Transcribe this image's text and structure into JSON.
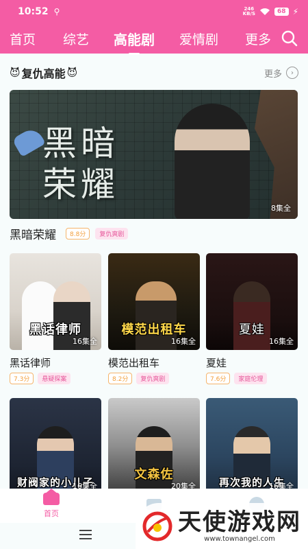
{
  "status_bar": {
    "time": "10:52",
    "usb_icon": "usb-icon",
    "network_speed_value": "246",
    "network_speed_unit": "KB/S",
    "battery": "68"
  },
  "top_nav": {
    "tabs": [
      {
        "label": "首页",
        "active": false
      },
      {
        "label": "综艺",
        "active": false
      },
      {
        "label": "高能剧",
        "active": true
      },
      {
        "label": "爱情剧",
        "active": false
      },
      {
        "label": "更多",
        "active": false
      }
    ],
    "search_icon": "search-icon"
  },
  "section": {
    "title": "复仇高能",
    "more_label": "更多"
  },
  "featured": {
    "poster_title_line1": "黑暗",
    "poster_title_line2": "荣耀",
    "episodes": "8集全",
    "name": "黑暗荣耀",
    "score": "8.8分",
    "tag": "复仇爽剧"
  },
  "cards": [
    {
      "poster_title": "黑话律师",
      "episodes": "16集全",
      "name": "黑话律师",
      "score": "7.3分",
      "tag": "悬疑探案"
    },
    {
      "poster_title": "模范出租车",
      "episodes": "16集全",
      "name": "模范出租车",
      "score": "8.2分",
      "tag": "复仇爽剧"
    },
    {
      "poster_title": "夏娃",
      "episodes": "16集全",
      "name": "夏娃",
      "score": "7.6分",
      "tag": "家庭伦理"
    },
    {
      "poster_title": "财阀家的小儿子",
      "episodes": "16集全",
      "name": "",
      "score": "",
      "tag": ""
    },
    {
      "poster_title": "文森佐",
      "episodes": "20集全",
      "name": "",
      "score": "",
      "tag": ""
    },
    {
      "poster_title": "再次我的人生",
      "episodes": "16集全",
      "name": "",
      "score": "",
      "tag": ""
    }
  ],
  "bottom_nav": {
    "home_label": "首页"
  },
  "watermark": {
    "title": "天使游戏网",
    "url": "www.townangel.com"
  },
  "colors": {
    "accent": "#f45ca4",
    "score": "#f29f3c",
    "tag_bg": "#fde3ef"
  }
}
